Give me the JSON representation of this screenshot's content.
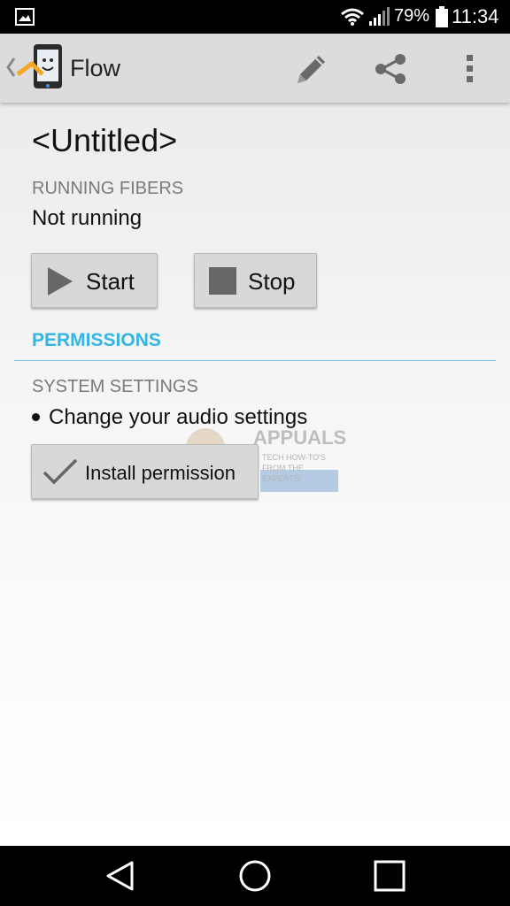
{
  "status_bar": {
    "battery_percent": "79%",
    "time": "11:34",
    "icons": [
      "gallery-icon",
      "wifi-icon",
      "signal-icon",
      "battery-icon"
    ]
  },
  "action_bar": {
    "title": "Flow",
    "actions": [
      "edit-icon",
      "share-icon",
      "overflow-menu-icon"
    ]
  },
  "flow": {
    "name": "<Untitled>",
    "running_label": "RUNNING FIBERS",
    "running_value": "Not running",
    "start_label": "Start",
    "stop_label": "Stop"
  },
  "permissions": {
    "header": "PERMISSIONS",
    "system_settings_label": "SYSTEM SETTINGS",
    "items": [
      "Change your audio settings"
    ],
    "install_label": "Install permission"
  },
  "watermark": {
    "brand": "APPUALS",
    "tagline": "TECH HOW-TO'S FROM THE EXPERTS!"
  },
  "colors": {
    "accent": "#33b5e5",
    "action_bar": "#dcdcdc",
    "button": "#d8d8d8"
  }
}
